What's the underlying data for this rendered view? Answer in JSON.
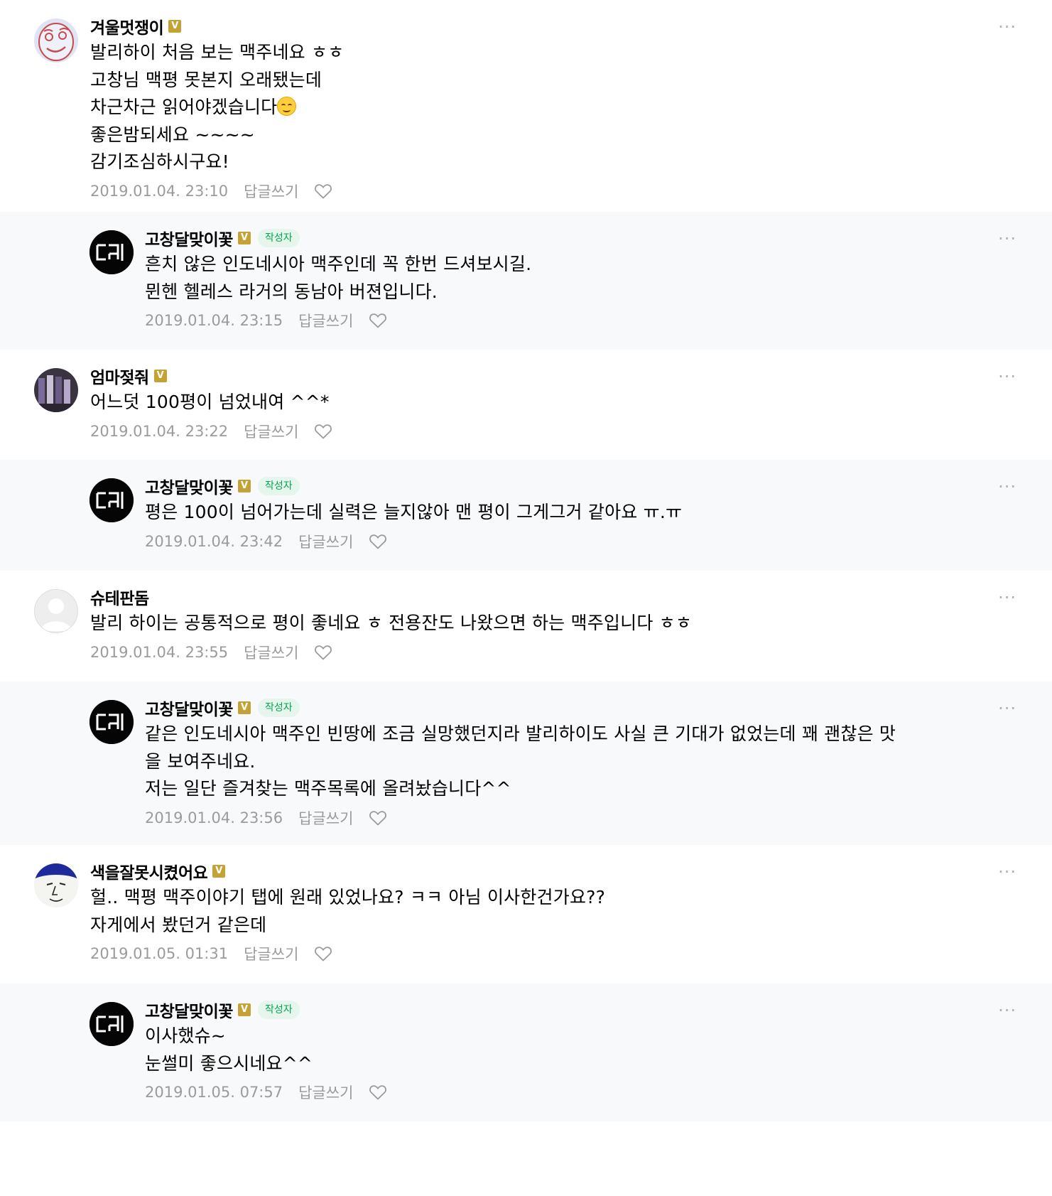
{
  "labels": {
    "reply": "답글쓰기",
    "author": "작성자",
    "badge": "V",
    "more": "···"
  },
  "comments": [
    {
      "nickname": "겨울멋쟁이",
      "text1": "발리하이 처음 보는 맥주네요 ㅎㅎ\n고창님 맥평 못본지 오래됐는데\n차근차근 읽어야겠습니다",
      "emoji": "smiling-face-emoji",
      "text2": "\n좋은밤되세요 ~~~~\n감기조심하시구요!",
      "date": "2019.01.04. 23:10"
    },
    {
      "nickname": "고창달맞이꽃",
      "text": "흔치 않은 인도네시아 맥주인데 꼭 한번 드셔보시길.\n뮌헨 헬레스 라거의 동남아 버젼입니다.",
      "date": "2019.01.04. 23:15"
    },
    {
      "nickname": "엄마젖줘",
      "text": "어느덧 100평이 넘었내여 ^^*",
      "date": "2019.01.04. 23:22"
    },
    {
      "nickname": "고창달맞이꽃",
      "text": "평은 100이 넘어가는데 실력은 늘지않아 맨 평이 그게그거 같아요 ㅠ.ㅠ",
      "date": "2019.01.04. 23:42"
    },
    {
      "nickname": "슈테판돔",
      "text": "발리 하이는 공통적으로 평이 좋네요 ㅎ 전용잔도 나왔으면 하는 맥주입니다 ㅎㅎ",
      "date": "2019.01.04. 23:55"
    },
    {
      "nickname": "고창달맞이꽃",
      "text": "같은 인도네시아 맥주인 빈땅에 조금 실망했던지라 발리하이도 사실 큰 기대가 없었는데 꽤 괜찮은 맛\n을 보여주네요.\n저는 일단 즐겨찾는 맥주목록에 올려놨습니다^^",
      "date": "2019.01.04. 23:56"
    },
    {
      "nickname": "색을잘못시켰어요",
      "text": "헐.. 맥평 맥주이야기 탭에 원래 있었나요? ㅋㅋ 아님 이사한건가요??\n자게에서 봤던거 같은데",
      "date": "2019.01.05. 01:31"
    },
    {
      "nickname": "고창달맞이꽃",
      "text": "이사했슈~\n눈썰미 좋으시네요^^",
      "date": "2019.01.05. 07:57"
    }
  ]
}
